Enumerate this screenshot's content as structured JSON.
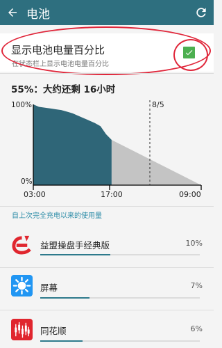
{
  "appbar": {
    "title": "电池",
    "back_icon": "arrow-left-icon",
    "refresh_icon": "refresh-icon",
    "background": "#2e6f7f"
  },
  "battery_percentage_setting": {
    "title": "显示电池电量百分比",
    "subtitle": "在状态栏上显示电池电量百分比",
    "checked": true,
    "checkbox_color": "#4caf50"
  },
  "status": {
    "text": "55%：大约还剩 16小时"
  },
  "chart_data": {
    "type": "area",
    "y_tick_labels": [
      "100%",
      "0%"
    ],
    "x_tick_labels": [
      "03:00",
      "17:00",
      "09:00"
    ],
    "marker_label": "8/5",
    "ylim": [
      0,
      100
    ],
    "grid": false,
    "series": [
      {
        "kind": "history",
        "color": "#2f6678",
        "points": [
          [
            0,
            100
          ],
          [
            1,
            97
          ],
          [
            2,
            96
          ],
          [
            3,
            95
          ],
          [
            4,
            94
          ],
          [
            5,
            93
          ],
          [
            6,
            91
          ],
          [
            7,
            89
          ],
          [
            8,
            86
          ],
          [
            9,
            83
          ],
          [
            10,
            80
          ],
          [
            11,
            77
          ],
          [
            12,
            73
          ],
          [
            13,
            63
          ],
          [
            14,
            56
          ]
        ]
      },
      {
        "kind": "projection",
        "color": "#c4c4c4",
        "points": [
          [
            14,
            56
          ],
          [
            30,
            0
          ]
        ]
      }
    ]
  },
  "usage_section": {
    "header": "自上次完全充电以来的使用量",
    "bar_color": "#2e7a8c",
    "items": [
      {
        "name": "益盟操盘手经典版",
        "percent": "10%",
        "value": 10,
        "icon": "emoney-app-icon"
      },
      {
        "name": "屏幕",
        "percent": "7%",
        "value": 7,
        "icon": "screen-brightness-icon"
      },
      {
        "name": "同花顺",
        "percent": "6%",
        "value": 6,
        "icon": "tonghuashun-app-icon"
      }
    ]
  }
}
